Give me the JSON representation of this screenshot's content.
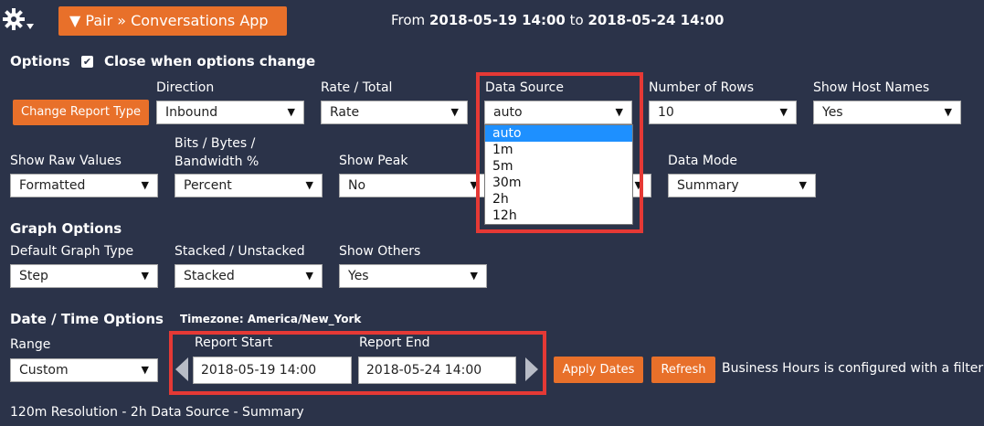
{
  "header": {
    "app_button_label": "▼ Pair » Conversations App",
    "range_from_word": "From",
    "range_start": "2018-05-19 14:00",
    "range_to_word": "to",
    "range_end": "2018-05-24 14:00"
  },
  "options": {
    "title": "Options",
    "close_when_change_label": "Close when options change",
    "close_when_change_checked": true,
    "change_report_type_label": "Change Report Type",
    "direction": {
      "label": "Direction",
      "value": "Inbound"
    },
    "rate_total": {
      "label": "Rate / Total",
      "value": "Rate"
    },
    "data_source": {
      "label": "Data Source",
      "value": "auto",
      "options": [
        "auto",
        "1m",
        "5m",
        "30m",
        "2h",
        "12h"
      ]
    },
    "number_of_rows": {
      "label": "Number of Rows",
      "value": "10"
    },
    "show_host_names": {
      "label": "Show Host Names",
      "value": "Yes"
    },
    "show_raw_values": {
      "label": "Show Raw Values",
      "value": "Formatted"
    },
    "bits_bytes": {
      "label_line1": "Bits / Bytes /",
      "label_line2": "Bandwidth %",
      "value": "Percent"
    },
    "show_peak": {
      "label": "Show Peak",
      "value": "No"
    },
    "data_mode": {
      "label": "Data Mode",
      "value": "Summary"
    }
  },
  "graph_options": {
    "title": "Graph Options",
    "default_graph_type": {
      "label": "Default Graph Type",
      "value": "Step"
    },
    "stacked": {
      "label": "Stacked / Unstacked",
      "value": "Stacked"
    },
    "show_others": {
      "label": "Show Others",
      "value": "Yes"
    }
  },
  "date_time": {
    "title": "Date / Time Options",
    "timezone": "Timezone: America/New_York",
    "range": {
      "label": "Range",
      "value": "Custom"
    },
    "report_start": {
      "label": "Report Start",
      "value": "2018-05-19 14:00"
    },
    "report_end": {
      "label": "Report End",
      "value": "2018-05-24 14:00"
    },
    "apply_dates_label": "Apply Dates",
    "refresh_label": "Refresh",
    "business_hours_note": "Business Hours is configured with a filter"
  },
  "footer": {
    "status": "120m Resolution - 2h Data Source - Summary"
  },
  "colors": {
    "background": "#2b3349",
    "accent_orange": "#e8702a",
    "highlight_red": "#e53935",
    "dropdown_selected": "#1e90ff"
  },
  "icons": [
    "gear-icon",
    "chevron-down-icon",
    "checkbox-checked-icon",
    "triangle-left-icon",
    "triangle-right-icon"
  ]
}
